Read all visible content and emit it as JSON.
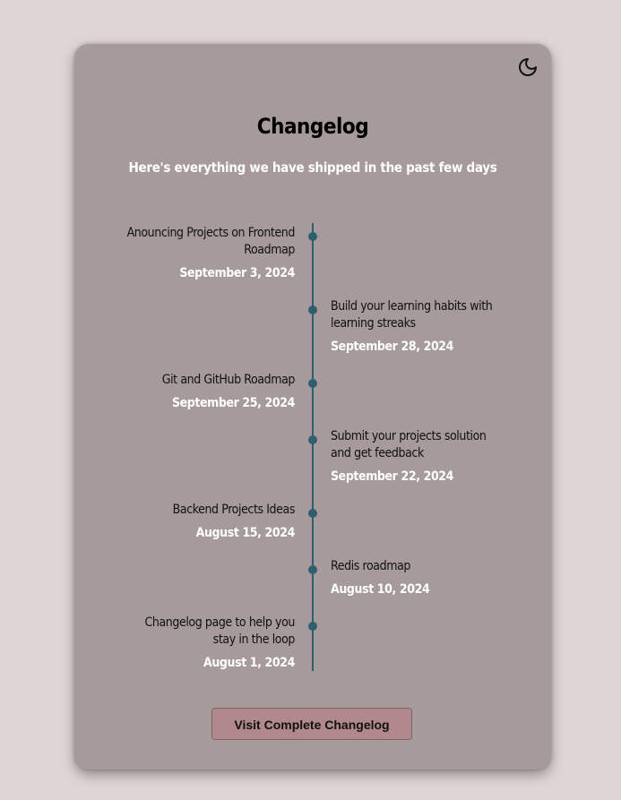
{
  "header": {
    "title": "Changelog",
    "subtitle": "Here's everything we have shipped in the past few days",
    "theme_icon": "moon-icon"
  },
  "entries": [
    {
      "title": "Anouncing Projects on Frontend Roadmap",
      "date": "September 3, 2024",
      "side": "left"
    },
    {
      "title": "Build your learning habits with learning streaks",
      "date": "September 28, 2024",
      "side": "right"
    },
    {
      "title": "Git and GitHub Roadmap",
      "date": "September 25, 2024",
      "side": "left"
    },
    {
      "title": "Submit your projects solution and get feedback",
      "date": "September 22, 2024",
      "side": "right"
    },
    {
      "title": "Backend Projects Ideas",
      "date": "August 15, 2024",
      "side": "left"
    },
    {
      "title": "Redis roadmap",
      "date": "August 10, 2024",
      "side": "right"
    },
    {
      "title": "Changelog page to help you stay in the loop",
      "date": "August 1, 2024",
      "side": "left"
    }
  ],
  "footer": {
    "button_label": "Visit Complete Changelog"
  },
  "colors": {
    "background": "#dfd4d6",
    "card": "#a69a9a",
    "timeline": "#2f5f6e",
    "button": "#b1888d"
  }
}
